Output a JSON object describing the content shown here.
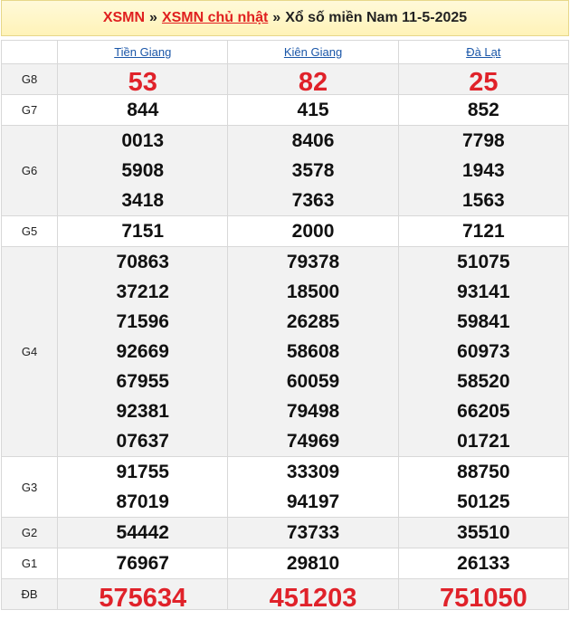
{
  "breadcrumb": {
    "home": "XSMN",
    "separator": "»",
    "section": "XSMN chủ nhật",
    "title": "Xổ số miền Nam 11-5-2025"
  },
  "provinces": [
    "Tiền Giang",
    "Kiên Giang",
    "Đà Lạt"
  ],
  "prizes": [
    {
      "label": "G8",
      "results": [
        [
          "53"
        ],
        [
          "82"
        ],
        [
          "25"
        ]
      ]
    },
    {
      "label": "G7",
      "results": [
        [
          "844"
        ],
        [
          "415"
        ],
        [
          "852"
        ]
      ]
    },
    {
      "label": "G6",
      "results": [
        [
          "0013",
          "5908",
          "3418"
        ],
        [
          "8406",
          "3578",
          "7363"
        ],
        [
          "7798",
          "1943",
          "1563"
        ]
      ]
    },
    {
      "label": "G5",
      "results": [
        [
          "7151"
        ],
        [
          "2000"
        ],
        [
          "7121"
        ]
      ]
    },
    {
      "label": "G4",
      "results": [
        [
          "70863",
          "37212",
          "71596",
          "92669",
          "67955",
          "92381",
          "07637"
        ],
        [
          "79378",
          "18500",
          "26285",
          "58608",
          "60059",
          "79498",
          "74969"
        ],
        [
          "51075",
          "93141",
          "59841",
          "60973",
          "58520",
          "66205",
          "01721"
        ]
      ]
    },
    {
      "label": "G3",
      "results": [
        [
          "91755",
          "87019"
        ],
        [
          "33309",
          "94197"
        ],
        [
          "88750",
          "50125"
        ]
      ]
    },
    {
      "label": "G2",
      "results": [
        [
          "54442"
        ],
        [
          "73733"
        ],
        [
          "35510"
        ]
      ]
    },
    {
      "label": "G1",
      "results": [
        [
          "76967"
        ],
        [
          "29810"
        ],
        [
          "26133"
        ]
      ]
    },
    {
      "label": "ĐB",
      "results": [
        [
          "575634"
        ],
        [
          "451203"
        ],
        [
          "751050"
        ]
      ]
    }
  ],
  "colors": {
    "highlight": "#e0222a",
    "link": "#1a56a8"
  }
}
